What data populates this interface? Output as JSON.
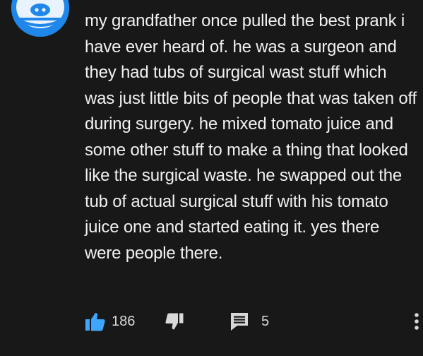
{
  "comment": {
    "text": "my grandfather once pulled the best prank i have ever heard of. he was a surgeon and they had tubs of surgical wast stuff which was just little bits of people that was taken off during surgery. he mixed tomato juice and some other stuff to make a thing that looked like the surgical waste. he swapped out the tub of actual surgical stuff with his tomato juice one and started eating it. yes there were people there."
  },
  "actions": {
    "like_count": "186",
    "reply_count": "5"
  },
  "icons": {
    "avatar": "pig-avatar-icon",
    "like": "thumbs-up-icon",
    "dislike": "thumbs-down-icon",
    "reply": "reply-icon",
    "more": "more-vertical-icon"
  },
  "colors": {
    "background": "#181818",
    "text": "#f1f1f1",
    "like_active": "#3ea6ff",
    "icon": "#d8d8d8",
    "avatar_bg": "#1f86ea"
  }
}
